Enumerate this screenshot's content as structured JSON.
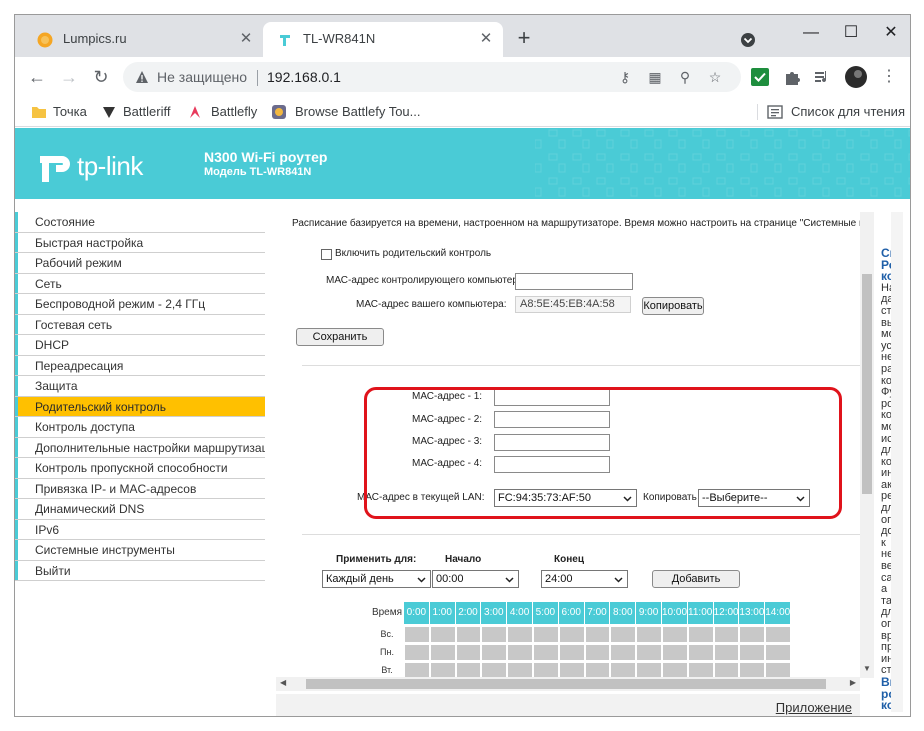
{
  "browser": {
    "tabs": [
      {
        "title": "Lumpics.ru",
        "active": false
      },
      {
        "title": "TL-WR841N",
        "active": true
      }
    ],
    "new_tab_symbol": "+",
    "window_controls": {
      "minimize": "—",
      "maximize": "☐",
      "close": "✕"
    },
    "security_label": "Не защищено",
    "url": "192.168.0.1",
    "bookmarks": [
      {
        "label": "Точка",
        "icon": "folder-icon"
      },
      {
        "label": "Battleriff",
        "icon": "battleriff-icon"
      },
      {
        "label": "Battlefly",
        "icon": "battlefly-icon"
      },
      {
        "label": "Browse Battlefy Tou...",
        "icon": "battlefy-icon"
      }
    ],
    "reading_list": "Список для чтения"
  },
  "router": {
    "brand": "tp-link",
    "product_name": "N300 Wi-Fi роутер",
    "model": "Модель TL-WR841N"
  },
  "menu": [
    {
      "label": "Состояние",
      "active": false
    },
    {
      "label": "Быстрая настройка",
      "active": false
    },
    {
      "label": "Рабочий режим",
      "active": false
    },
    {
      "label": "Сеть",
      "active": false
    },
    {
      "label": "Беспроводной режим - 2,4 ГГц",
      "active": false
    },
    {
      "label": "Гостевая сеть",
      "active": false
    },
    {
      "label": "DHCP",
      "active": false
    },
    {
      "label": "Переадресация",
      "active": false
    },
    {
      "label": "Защита",
      "active": false
    },
    {
      "label": "Родительский контроль",
      "active": true
    },
    {
      "label": "Контроль доступа",
      "active": false
    },
    {
      "label": "Дополнительные настройки маршрутизации",
      "active": false
    },
    {
      "label": "Контроль пропускной способности",
      "active": false
    },
    {
      "label": "Привязка IP- и MAC-адресов",
      "active": false
    },
    {
      "label": "Динамический DNS",
      "active": false
    },
    {
      "label": "IPv6",
      "active": false
    },
    {
      "label": "Системные инструменты",
      "active": false
    },
    {
      "label": "Выйти",
      "active": false
    }
  ],
  "content": {
    "intro": "Расписание базируется на времени, настроенном на маршрутизаторе. Время можно настроить на странице \"Системные и",
    "enable_parental_label": "Включить родительский контроль",
    "enable_parental_checked": false,
    "controlling_mac_label": "МАС-адрес контролирующего компьютера",
    "controlling_mac_value": "",
    "your_mac_label": "МАС-адрес вашего компьютера:",
    "your_mac_value": "A8:5E:45:EB:4A:58",
    "copy_button": "Копировать",
    "save_button": "Сохранить",
    "mac_fields": [
      {
        "label": "МАС-адрес - 1:",
        "value": ""
      },
      {
        "label": "МАС-адрес - 2:",
        "value": ""
      },
      {
        "label": "МАС-адрес - 3:",
        "value": ""
      },
      {
        "label": "МАС-адрес - 4:",
        "value": ""
      }
    ],
    "lan_mac_label": "МАС-адрес в текущей LAN:",
    "lan_mac_value": "FC:94:35:73:AF:50",
    "copy_label": "Копировать",
    "copy_select_value": "--Выберите--",
    "apply_for_label": "Применить для:",
    "start_label": "Начало",
    "end_label": "Конец",
    "apply_for_value": "Каждый день",
    "start_value": "00:00",
    "end_value": "24:00",
    "add_button": "Добавить",
    "schedule": {
      "time_header": "Время",
      "hours": [
        "0:00",
        "1:00",
        "2:00",
        "3:00",
        "4:00",
        "5:00",
        "6:00",
        "7:00",
        "8:00",
        "9:00",
        "10:00",
        "11:00",
        "12:00",
        "13:00",
        "14:00"
      ],
      "days": [
        "Вс.",
        "Пн.",
        "Вт."
      ]
    }
  },
  "help_column": {
    "lines": [
      "Сп",
      "Ро",
      "ко",
      "",
      "На",
      "да",
      "стр",
      "вы",
      "мо",
      "уст",
      "не",
      "pa",
      "ко",
      "Фу",
      "ро",
      "ко",
      "мо",
      "исі",
      "дл",
      "ко",
      "ин",
      "акт",
      "ре",
      "дл",
      "ог",
      "до",
      "к",
      "не",
      "веб",
      "са",
      "а",
      "та",
      "дл",
      "ог",
      "вр",
      "пре",
      "ин",
      "стр",
      "",
      "Вк",
      "ро",
      "ко"
    ]
  },
  "footer_link": "Приложение"
}
